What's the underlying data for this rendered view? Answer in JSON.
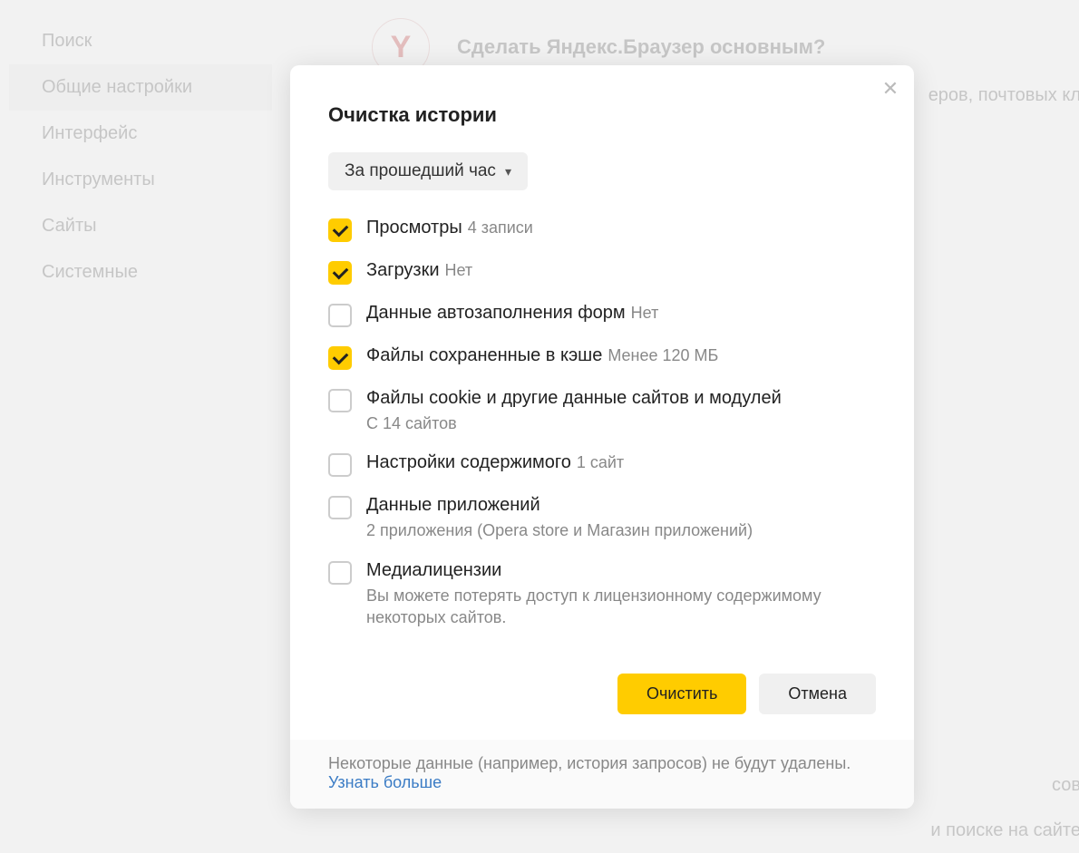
{
  "sidebar": {
    "items": [
      {
        "label": "Поиск"
      },
      {
        "label": "Общие настройки"
      },
      {
        "label": "Интерфейс"
      },
      {
        "label": "Инструменты"
      },
      {
        "label": "Сайты"
      },
      {
        "label": "Системные"
      }
    ]
  },
  "main": {
    "logo_letter": "Y",
    "prompt_title": "Сделать Яндекс.Браузер основным?",
    "bg_text_1": "еров, почтовых кл",
    "bg_text_2": "сов",
    "bg_text_3": "и поиске на сайте"
  },
  "modal": {
    "title": "Очистка истории",
    "time_range": "За прошедший час",
    "options": [
      {
        "checked": true,
        "label": "Просмотры",
        "inline": "4 записи",
        "sub": ""
      },
      {
        "checked": true,
        "label": "Загрузки",
        "inline": "Нет",
        "sub": ""
      },
      {
        "checked": false,
        "label": "Данные автозаполнения форм",
        "inline": "Нет",
        "sub": ""
      },
      {
        "checked": true,
        "label": "Файлы сохраненные в кэше",
        "inline": "Менее 120 МБ",
        "sub": ""
      },
      {
        "checked": false,
        "label": "Файлы cookie и другие данные сайтов и модулей",
        "inline": "",
        "sub": "С 14 сайтов"
      },
      {
        "checked": false,
        "label": "Настройки содержимого",
        "inline": "1 сайт",
        "sub": ""
      },
      {
        "checked": false,
        "label": "Данные приложений",
        "inline": "",
        "sub": "2 приложения (Opera store и Магазин приложений)"
      },
      {
        "checked": false,
        "label": "Медиалицензии",
        "inline": "",
        "sub": "Вы можете потерять доступ к лицензионному содержимому некоторых сайтов."
      }
    ],
    "primary_btn": "Очистить",
    "secondary_btn": "Отмена",
    "footer_note": "Некоторые данные (например, история запросов) не будут удалены.",
    "footer_link": "Узнать больше"
  }
}
